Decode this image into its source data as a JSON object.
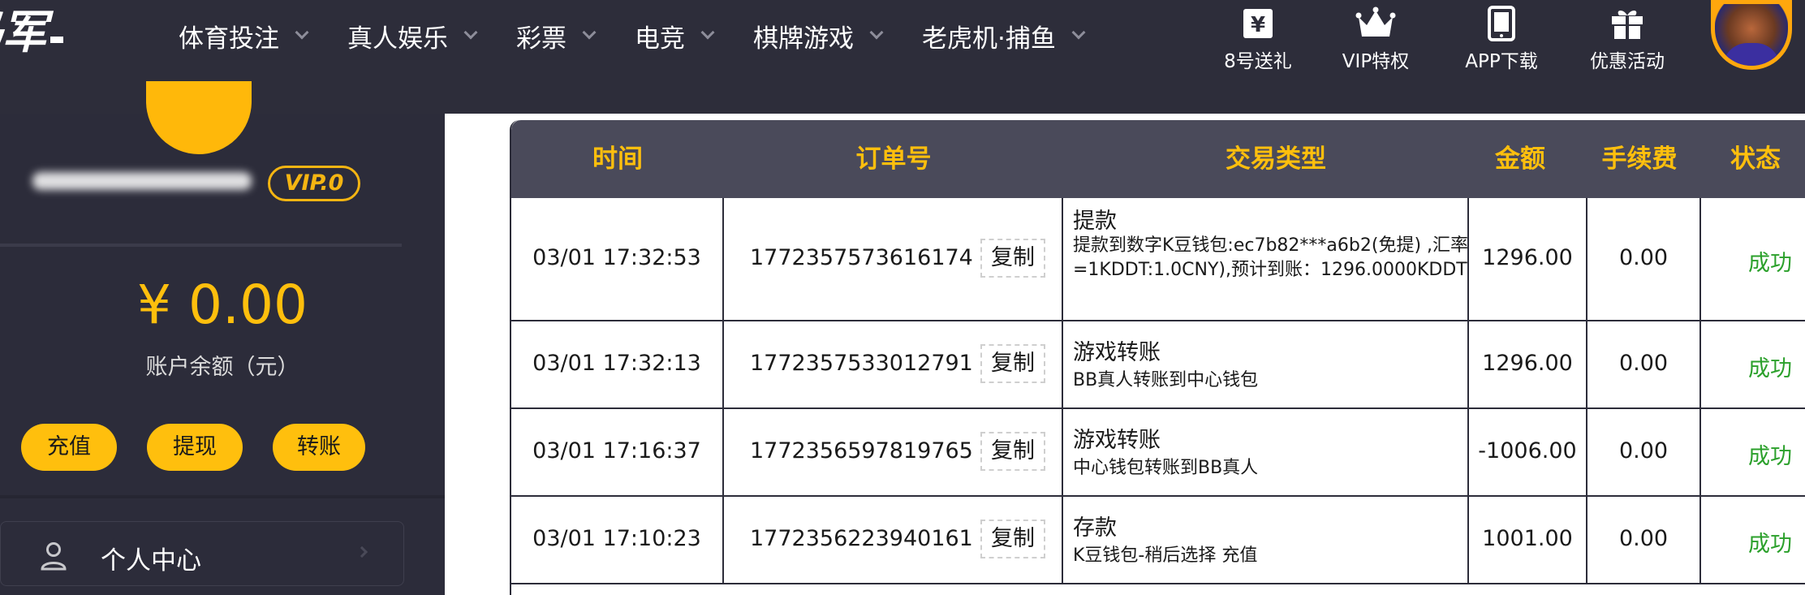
{
  "brand": {
    "logo_text": "马军"
  },
  "nav": {
    "items": [
      {
        "label": "体育投注"
      },
      {
        "label": "真人娱乐"
      },
      {
        "label": "彩票"
      },
      {
        "label": "电竞"
      },
      {
        "label": "棋牌游戏"
      },
      {
        "label": "老虎机·捕鱼"
      }
    ]
  },
  "quick_links": [
    {
      "label": "8号送礼",
      "icon": "gift-money-icon"
    },
    {
      "label": "VIP特权",
      "icon": "crown-icon"
    },
    {
      "label": "APP下载",
      "icon": "tablet-icon"
    },
    {
      "label": "优惠活动",
      "icon": "gift-box-icon"
    }
  ],
  "account": {
    "vip_level": "VIP.0",
    "balance": "¥ 0.00",
    "balance_label": "账户余额（元）",
    "actions": [
      {
        "label": "充值"
      },
      {
        "label": "提现"
      },
      {
        "label": "转账"
      }
    ],
    "menu": [
      {
        "label": "个人中心",
        "icon": "user-icon"
      }
    ]
  },
  "table": {
    "headers": {
      "time": "时间",
      "order": "订单号",
      "type": "交易类型",
      "amount": "金额",
      "fee": "手续费",
      "status": "状态"
    },
    "copy_label": "复制",
    "rows": [
      {
        "time": "03/01 17:32:53",
        "order": "1772357573616174",
        "type_title": "提款",
        "type_desc": "提款到数字K豆钱包:ec7b82***a6b2(免提) ,汇率=1KDDT:1.0CNY),预计到账：1296.0000KDDT",
        "amount": "1296.00",
        "fee": "0.00",
        "status": "成功"
      },
      {
        "time": "03/01 17:32:13",
        "order": "1772357533012791",
        "type_title": "游戏转账",
        "type_desc": "BB真人转账到中心钱包",
        "amount": "1296.00",
        "fee": "0.00",
        "status": "成功"
      },
      {
        "time": "03/01 17:16:37",
        "order": "1772356597819765",
        "type_title": "游戏转账",
        "type_desc": "中心钱包转账到BB真人",
        "amount": "-1006.00",
        "fee": "0.00",
        "status": "成功"
      },
      {
        "time": "03/01 17:10:23",
        "order": "1772356223940161",
        "type_title": "存款",
        "type_desc": "K豆钱包-稍后选择 充值",
        "amount": "1001.00",
        "fee": "0.00",
        "status": "成功"
      }
    ]
  },
  "colors": {
    "header_bg": "#2d2d3a",
    "sidebar_bg": "#2c2c3a",
    "accent": "#ffbf0d",
    "table_header_bg": "#4a4a5a",
    "success": "#2ba02b"
  }
}
